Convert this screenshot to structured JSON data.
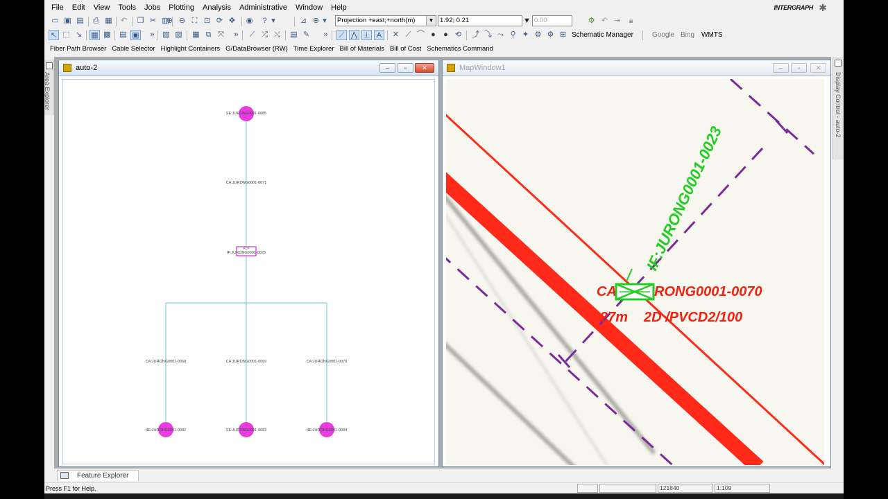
{
  "menu": [
    "File",
    "Edit",
    "View",
    "Tools",
    "Jobs",
    "Plotting",
    "Analysis",
    "Administrative",
    "Window",
    "Help"
  ],
  "brand": "INTERGRAPH",
  "toolbar": {
    "projection": "Projection +east;+north(m)",
    "coords": "1.92; 0.21",
    "value_field": "0.00",
    "schematic_manager": "Schematic Manager",
    "google": "Google",
    "bing": "Bing",
    "wmts": "WMTS"
  },
  "commands": [
    "Fiber Path Browser",
    "Cable Selector",
    "Highlight Containers",
    "G/DataBrowser (RW)",
    "Time Explorer",
    "Bill of Materials",
    "Bill of Cost",
    "Schematics Command"
  ],
  "left_dock": "Area Explorer",
  "right_dock": "Display Control - auto-2",
  "schematic_window": {
    "title": "auto-2",
    "labels": {
      "se_top": "SE:JURONG0001-0085",
      "ca_top": "CA:JURONG0001-0071",
      "if_node": "IF:JURONG0001-0023",
      "if_tag": "FCP",
      "ca_left": "CA:JURONG0001-0068",
      "ca_mid": "CA:JURONG0001-0069",
      "ca_right": "CA:JURONG0001-0070",
      "se_left": "SE:JURONG0001-0082",
      "se_mid": "SE:JURONG0001-0083",
      "se_right": "SE:JURONG0001-0084"
    },
    "colors": {
      "line": "#5bc8d2",
      "node": "#e83ce0",
      "box": "#cc33cc"
    }
  },
  "map_window": {
    "title": "MapWindow1",
    "labels": {
      "if_label": "IF:JURONG0001-0023",
      "ca_label_left": "CA",
      "ca_label_right": "RONG0001-0070",
      "cable_spec_left": "27m",
      "cable_spec_right": "2D /PVCD2/100"
    },
    "colors": {
      "background": "#f8f7ef",
      "cable": "#ff2a1a",
      "green": "#22cc22",
      "purple": "#7a2a9a"
    }
  },
  "tabs": [
    "Feature Explorer"
  ],
  "status": {
    "text": "Press F1 for Help.",
    "panel_value": "121840",
    "scale": "1:109"
  }
}
